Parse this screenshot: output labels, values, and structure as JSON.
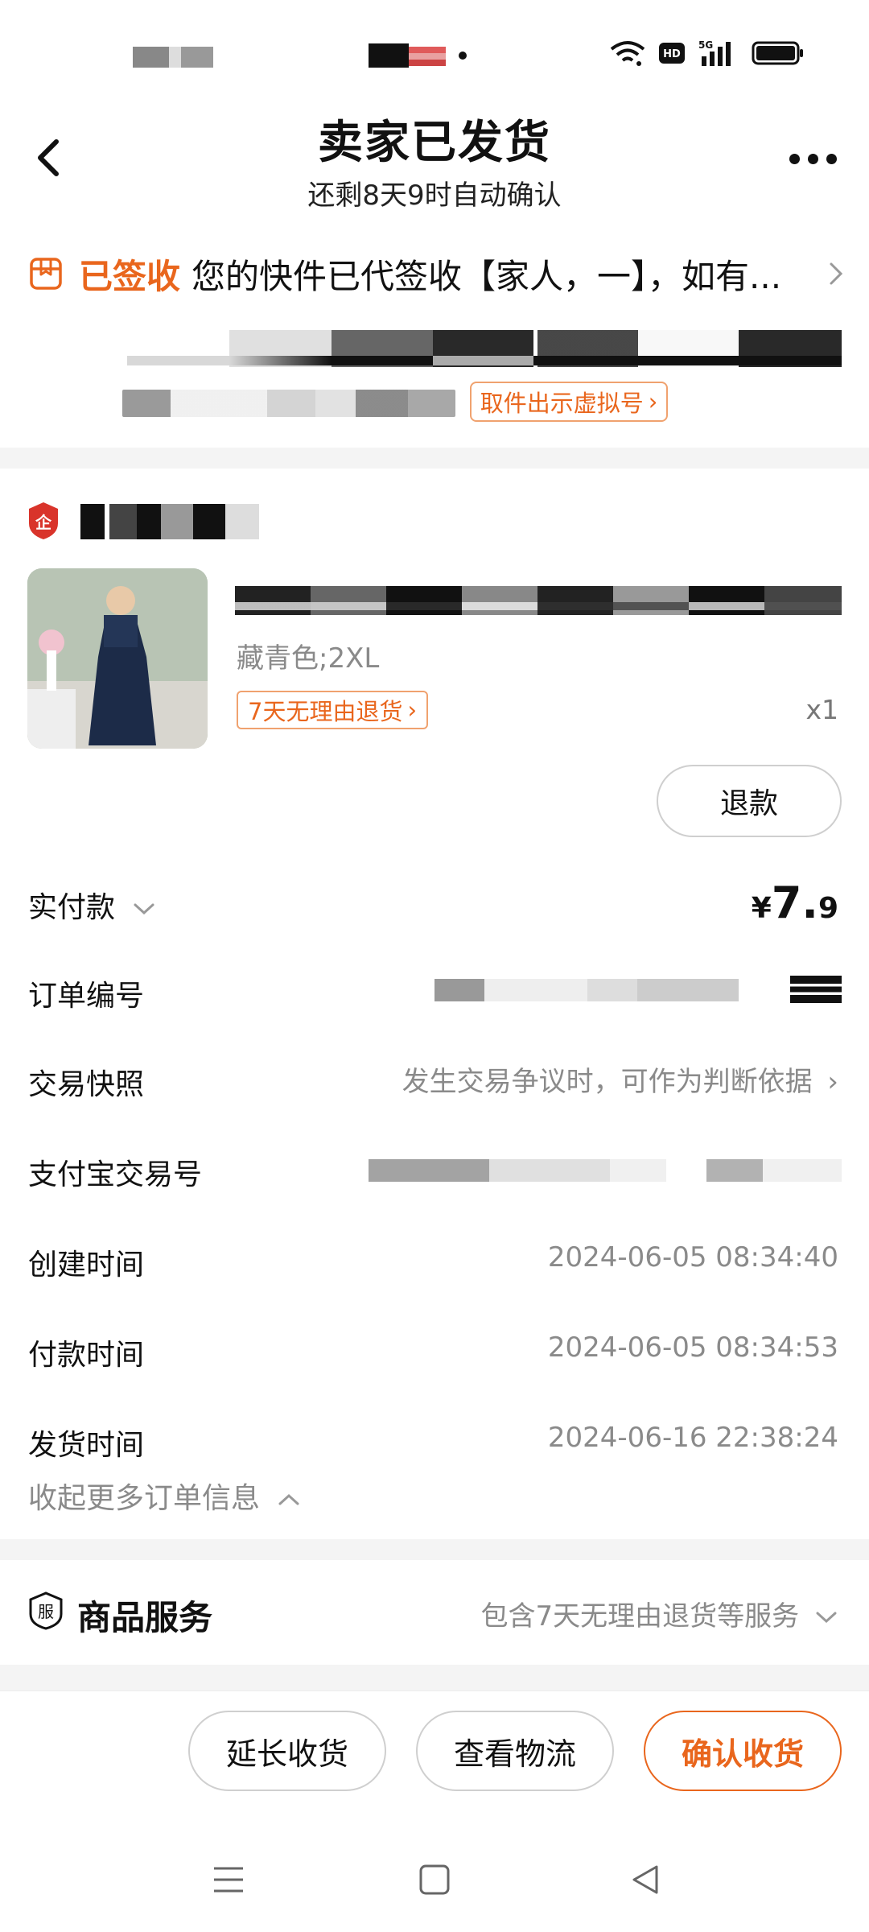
{
  "header": {
    "title": "卖家已发货",
    "subtitle": "还剩8天9时自动确认"
  },
  "delivery": {
    "status": "已签收",
    "message": "您的快件已代签收【家人，一】，如有...",
    "pickup_button": "取件出示虚拟号"
  },
  "product": {
    "sku": "藏青色;2XL",
    "return_badge": "7天无理由退货",
    "quantity": "x1",
    "refund_button": "退款"
  },
  "order": {
    "paid_label": "实付款",
    "price_currency": "¥",
    "price_int": "7.",
    "price_dec": "9",
    "order_no_label": "订单编号",
    "snapshot_label": "交易快照",
    "snapshot_value": "发生交易争议时，可作为判断依据",
    "alipay_label": "支付宝交易号",
    "created_label": "创建时间",
    "created_value": "2024-06-05 08:34:40",
    "paid_time_label": "付款时间",
    "paid_time_value": "2024-06-05 08:34:53",
    "shipped_label": "发货时间",
    "shipped_value": "2024-06-16 22:38:24",
    "collapse_label": "收起更多订单信息"
  },
  "services": {
    "icon_char": "服",
    "title": "商品服务",
    "value": "包含7天无理由退货等服务"
  },
  "actions": {
    "extend": "延长收货",
    "track": "查看物流",
    "confirm": "确认收货"
  },
  "colors": {
    "accent": "#e9661d",
    "muted": "#8a8a8a",
    "divider": "#f4f4f4"
  }
}
